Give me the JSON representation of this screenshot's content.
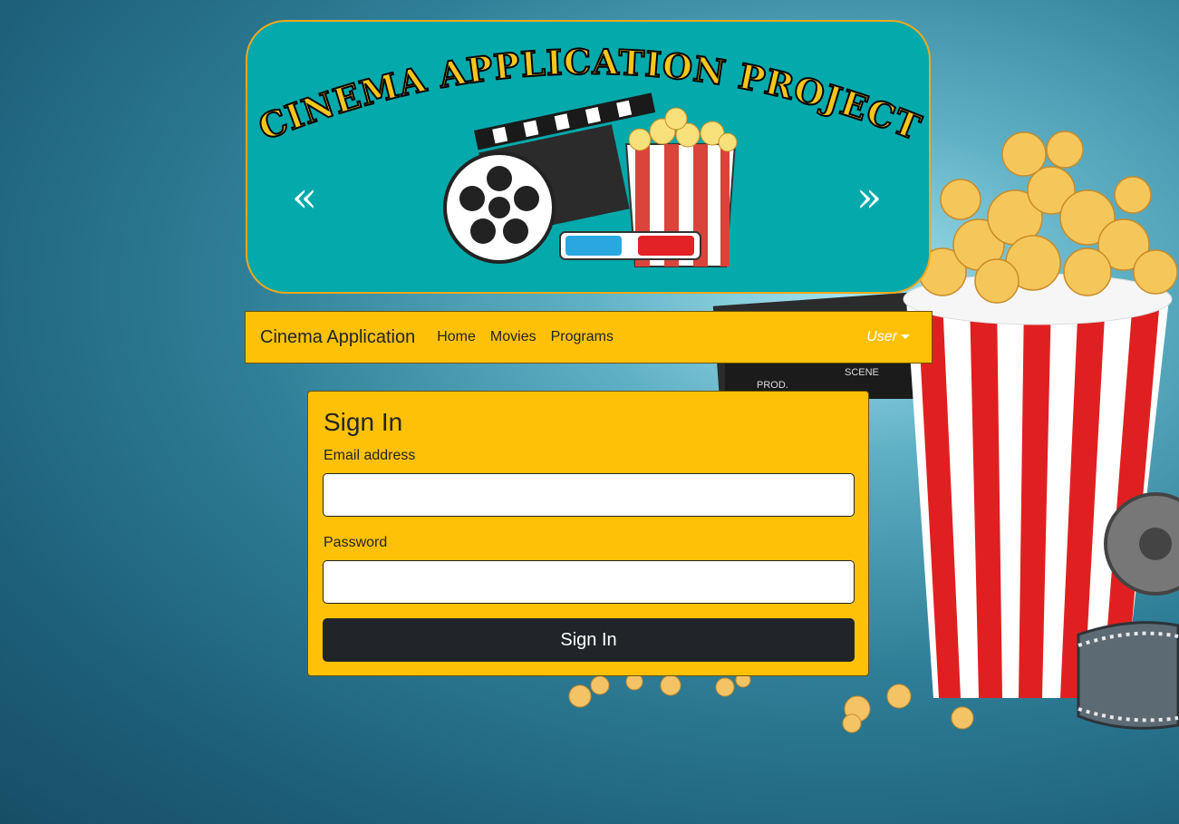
{
  "banner": {
    "title_art": "CINEMA APPLICATION PROJECT",
    "prev_label": "«",
    "next_label": "»",
    "border_color": "#f0a91a",
    "background_color": "#03a9ab"
  },
  "navbar": {
    "brand": "Cinema Application",
    "links": [
      "Home",
      "Movies",
      "Programs"
    ],
    "user_label": "User",
    "background_color": "#ffc107"
  },
  "signin": {
    "title": "Sign In",
    "email_label": "Email address",
    "email_value": "",
    "password_label": "Password",
    "password_value": "",
    "submit_label": "Sign In",
    "background_color": "#ffc107",
    "button_color": "#212529"
  },
  "background": {
    "description_icons": [
      "popcorn-bucket-icon",
      "clapperboard-icon",
      "film-reel-icon"
    ]
  }
}
